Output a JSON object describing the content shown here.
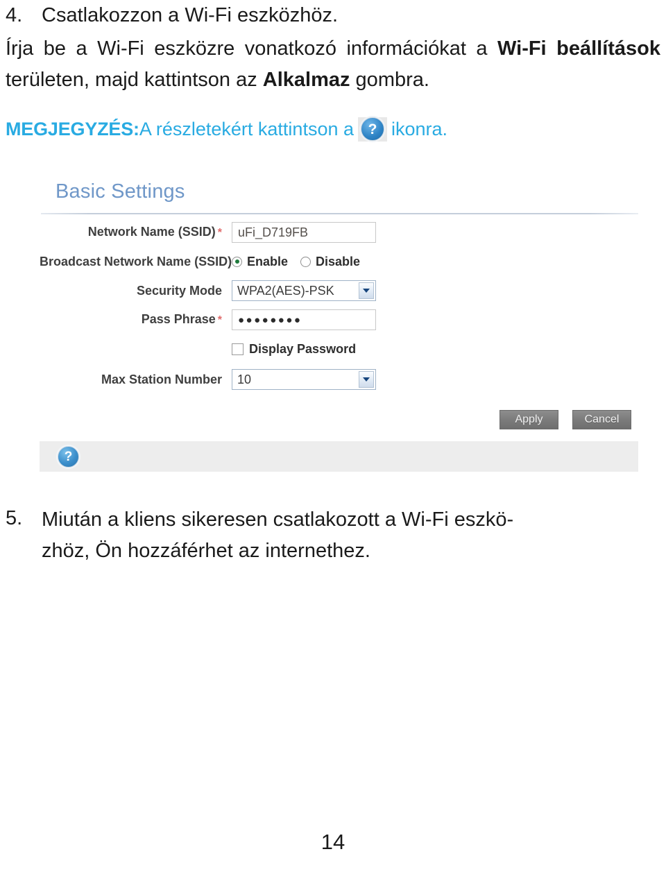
{
  "document": {
    "page_number": "14",
    "language": "hu"
  },
  "step4": {
    "number": "4.",
    "heading": "Csatlakozzon a Wi-Fi eszközhöz.",
    "paragraph_part1": "Írja be a Wi-Fi eszközre vonatkozó információkat a ",
    "paragraph_bold1": "Wi-Fi beállítások",
    "paragraph_part2": " területen, majd kattintson az ",
    "paragraph_bold2": "Alkalmaz",
    "paragraph_part3": " gombra."
  },
  "note": {
    "label": "MEGJEGYZÉS:",
    "text_before_icon": " A részletekért kattintson a",
    "icon_name": "help-question-icon",
    "icon_glyph": "?",
    "text_after_icon": "ikonra.",
    "color": "#29abe2"
  },
  "router_panel": {
    "title": "Basic Settings",
    "title_color": "#6f97c8",
    "fields": [
      {
        "label": "Network Name (SSID)",
        "required": true,
        "required_mark": "*",
        "type": "text",
        "value": "uFi_D719FB"
      },
      {
        "label": "Broadcast Network Name (SSID)",
        "required": false,
        "type": "radio",
        "options": [
          {
            "label": "Enable",
            "selected": true
          },
          {
            "label": "Disable",
            "selected": false
          }
        ]
      },
      {
        "label": "Security Mode",
        "required": false,
        "type": "select",
        "value": "WPA2(AES)-PSK"
      },
      {
        "label": "Pass Phrase",
        "required": true,
        "required_mark": "*",
        "type": "password",
        "value": "●●●●●●●●"
      },
      {
        "label": "",
        "required": false,
        "type": "checkbox",
        "checkbox_label": "Display Password",
        "checked": false
      },
      {
        "label": "Max Station Number",
        "required": false,
        "type": "select",
        "value": "10"
      }
    ],
    "buttons": {
      "apply": "Apply",
      "cancel": "Cancel"
    },
    "footer": {
      "help_icon_glyph": "?",
      "help_icon_name": "help-question-icon"
    }
  },
  "step5": {
    "number": "5.",
    "line1": "Miután a kliens sikeresen csatlakozott a Wi-Fi eszkö-",
    "line2": "zhöz, Ön hozzáférhet az internethez."
  }
}
